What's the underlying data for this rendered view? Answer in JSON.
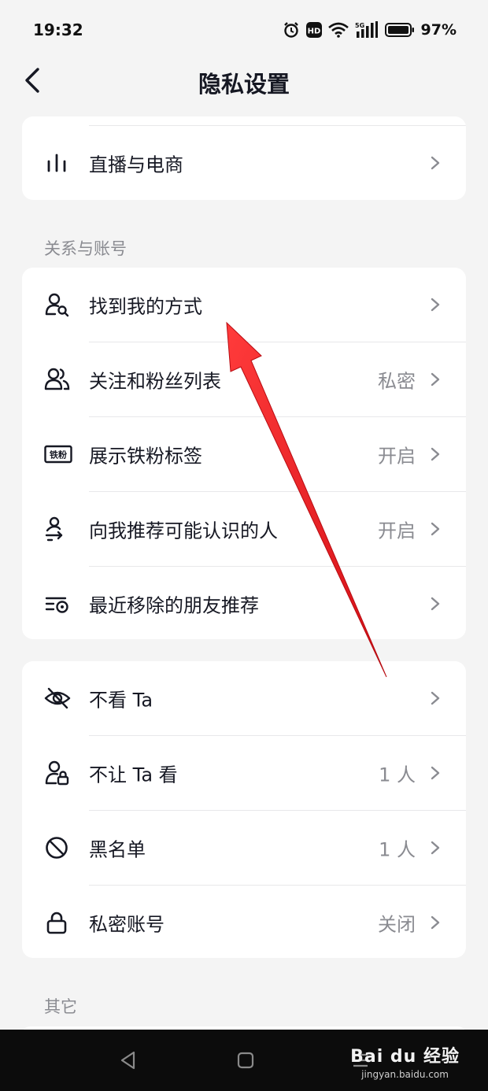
{
  "status_bar": {
    "time": "19:32",
    "battery_percent": "97%",
    "network": "5G"
  },
  "header": {
    "title": "隐私设置"
  },
  "top_card": {
    "items": [
      {
        "label": "直播与电商",
        "icon": "bar-chart-icon"
      }
    ]
  },
  "relations_section": {
    "title": "关系与账号",
    "items": [
      {
        "label": "找到我的方式",
        "value": "",
        "icon": "person-search-icon"
      },
      {
        "label": "关注和粉丝列表",
        "value": "私密",
        "icon": "people-icon"
      },
      {
        "label": "展示铁粉标签",
        "value": "开启",
        "icon": "iron-fan-badge-icon",
        "badge_text": "铁粉"
      },
      {
        "label": "向我推荐可能认识的人",
        "value": "开启",
        "icon": "recommend-people-icon"
      },
      {
        "label": "最近移除的朋友推荐",
        "value": "",
        "icon": "list-eye-icon"
      }
    ]
  },
  "block_card": {
    "items": [
      {
        "label": "不看 Ta",
        "value": "",
        "icon": "eye-off-icon"
      },
      {
        "label": "不让 Ta 看",
        "value": "1 人",
        "icon": "person-lock-icon"
      },
      {
        "label": "黑名单",
        "value": "1 人",
        "icon": "block-icon"
      },
      {
        "label": "私密账号",
        "value": "关闭",
        "icon": "lock-icon"
      }
    ]
  },
  "other_section": {
    "title": "其它"
  },
  "watermark": {
    "brand": "Bai du 经验",
    "url": "jingyan.baidu.com"
  },
  "colors": {
    "background": "#f4f4f4",
    "card": "#ffffff",
    "annotation_arrow": "#e8141b",
    "secondary_text": "#8a8b91"
  }
}
